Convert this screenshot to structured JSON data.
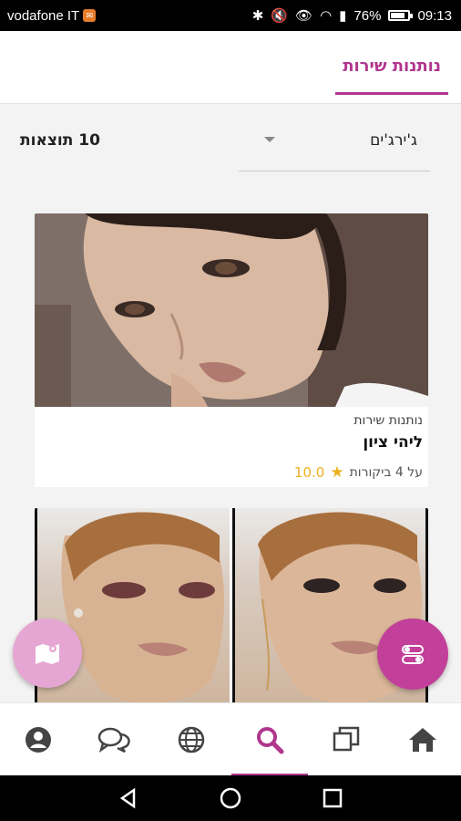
{
  "status_bar": {
    "carrier": "vodafone IT",
    "battery": "76%",
    "time": "09:13",
    "battery_level": 0.76
  },
  "header": {
    "active_tab": "נותנות שירות"
  },
  "filters": {
    "results_count": "10 תוצאות",
    "dropdown_value": "ג'ירג'ים"
  },
  "cards": [
    {
      "type": "נותנות שירות",
      "name": "ליהי ציון",
      "score": "10.0",
      "reviews": "על 4 ביקורות"
    }
  ],
  "bottom_nav": [
    "profile-icon",
    "chat-icon",
    "globe-icon",
    "search-icon",
    "copy-icon",
    "home-icon"
  ],
  "colors": {
    "accent": "#b0368e",
    "star": "#e9b220",
    "fab_map": "#e6a6d3",
    "fab_filter": "#c2409a"
  }
}
